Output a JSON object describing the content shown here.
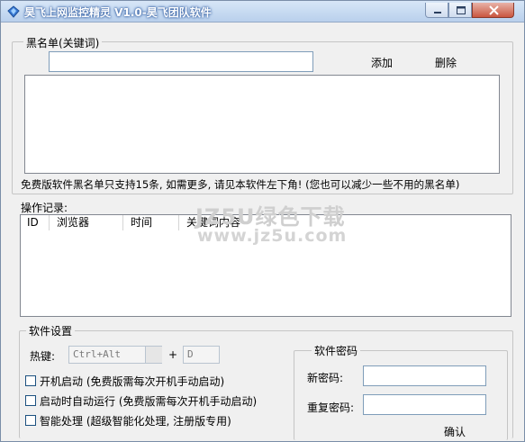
{
  "window": {
    "title": "昊飞上网监控精灵 V1.0-昊飞团队软件"
  },
  "blacklist": {
    "group_label": "黑名单(关键词)",
    "keyword_value": "",
    "add_label": "添加",
    "delete_label": "删除",
    "note": "免费版软件黑名单只支持15条, 如需更多, 请见本软件左下角! (您也可以减少一些不用的黑名单)"
  },
  "log": {
    "label": "操作记录:",
    "columns": [
      "ID",
      "浏览器",
      "时间",
      "关键词内容"
    ]
  },
  "settings": {
    "group_label": "软件设置",
    "hotkey_label": "热键:",
    "hotkey_value": "Ctrl+Alt",
    "plus": "+",
    "hotkey_key": "D",
    "options": [
      "开机启动 (免费版需每次开机手动启动)",
      "启动时自动运行 (免费版需每次开机手动启动)",
      "智能处理 (超级智能化处理, 注册版专用)"
    ]
  },
  "password": {
    "group_label": "软件密码",
    "new_label": "新密码:",
    "repeat_label": "重复密码:",
    "new_value": "",
    "repeat_value": "",
    "confirm_label": "确认"
  },
  "watermark": {
    "line1": "JZ5U绿色下载",
    "line2": "www.jz5u.com"
  },
  "icons": {
    "app": "app-icon",
    "minimize": "minimize-icon",
    "maximize": "maximize-icon",
    "close": "close-icon"
  }
}
